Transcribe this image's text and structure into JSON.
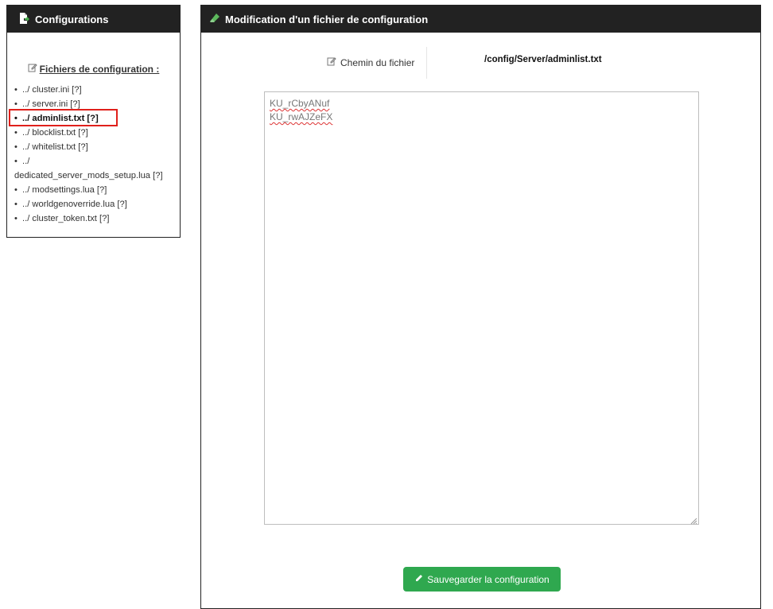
{
  "left_panel": {
    "title": "Configurations",
    "icon": "file-export-icon",
    "files_title": "Fichiers de configuration :",
    "files_title_icon": "edit-icon",
    "files": [
      {
        "label": "../ cluster.ini [?]",
        "active": false
      },
      {
        "label": "../ server.ini [?]",
        "active": false
      },
      {
        "label": "../ adminlist.txt [?]",
        "active": true
      },
      {
        "label": "../ blocklist.txt [?]",
        "active": false
      },
      {
        "label": "../ whitelist.txt [?]",
        "active": false
      },
      {
        "label_line1": "../",
        "label_line2": "dedicated_server_mods_setup.lua [?]",
        "active": false
      },
      {
        "label": "../ modsettings.lua [?]",
        "active": false
      },
      {
        "label": "../ worldgenoverride.lua [?]",
        "active": false
      },
      {
        "label": "../ cluster_token.txt [?]",
        "active": false
      }
    ]
  },
  "right_panel": {
    "title": "Modification d'un fichier de configuration",
    "icon": "eraser-icon",
    "path_label": "Chemin du fichier",
    "path_label_icon": "edit-icon",
    "path_value": "/config/Server/adminlist.txt",
    "editor_lines": [
      "KU_rCbyANuf",
      "KU_rwAJZeFX"
    ],
    "save_label": "Sauvegarder la configuration",
    "save_icon": "pencil-icon"
  },
  "colors": {
    "header_bg": "#222222",
    "accent_green": "#2fa84f",
    "highlight_red": "#e0201b"
  }
}
